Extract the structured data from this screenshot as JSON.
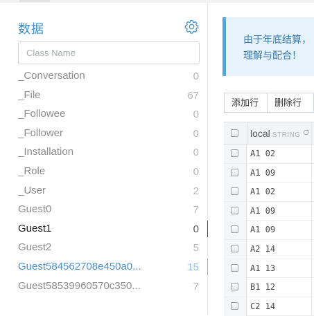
{
  "sidebar": {
    "title": "数据",
    "search_placeholder": "Class Name",
    "classes": [
      {
        "name": "_Conversation",
        "count": "0"
      },
      {
        "name": "_File",
        "count": "67"
      },
      {
        "name": "_Followee",
        "count": "0"
      },
      {
        "name": "_Follower",
        "count": "0"
      },
      {
        "name": "_Installation",
        "count": "0"
      },
      {
        "name": "_Role",
        "count": "0"
      },
      {
        "name": "_User",
        "count": "2"
      },
      {
        "name": "Guest0",
        "count": "7"
      },
      {
        "name": "Guest1",
        "count": "0"
      },
      {
        "name": "Guest2",
        "count": "5"
      },
      {
        "name": "Guest584562708e450a0...",
        "count": "15"
      },
      {
        "name": "Guest58539960570c350...",
        "count": "7"
      }
    ]
  },
  "notice": {
    "line1": "由于年底结算，",
    "line2": "理解与配合！"
  },
  "toolbar": {
    "add_row": "添加行",
    "delete_row": "删除行"
  },
  "grid": {
    "column_name": "local",
    "column_type": "STRING",
    "rows": [
      "A1 02",
      "A1 09",
      "A1 02",
      "A1 09",
      "A1 09",
      "A2 14",
      "A1 13",
      "B1 12",
      "C2 14"
    ]
  }
}
